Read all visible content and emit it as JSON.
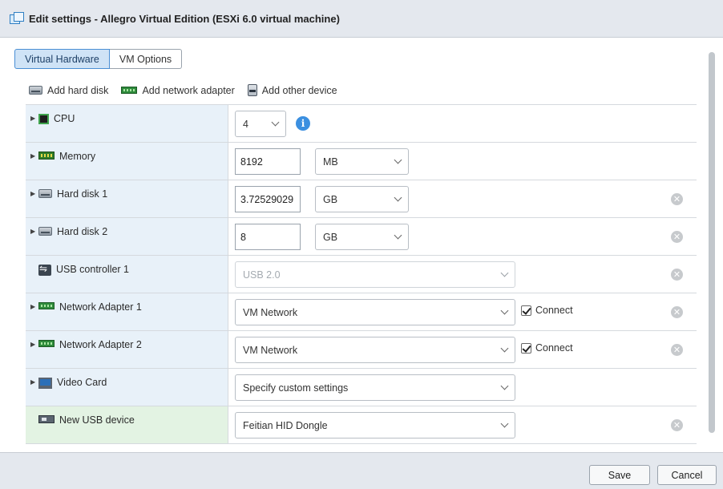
{
  "window": {
    "title": "Edit settings - Allegro Virtual Edition (ESXi 6.0 virtual machine)"
  },
  "tabs": [
    {
      "label": "Virtual Hardware",
      "active": true
    },
    {
      "label": "VM Options",
      "active": false
    }
  ],
  "toolbar": {
    "add_hard_disk": "Add hard disk",
    "add_network_adapter": "Add network adapter",
    "add_other_device": "Add other device"
  },
  "hardware": {
    "cpu": {
      "label": "CPU",
      "value": "4",
      "icon": "cpu-icon"
    },
    "memory": {
      "label": "Memory",
      "value": "8192",
      "unit": "MB",
      "icon": "memory-icon"
    },
    "hard_disk_1": {
      "label": "Hard disk 1",
      "value": "3.72529029",
      "unit": "GB",
      "icon": "hard-disk-icon"
    },
    "hard_disk_2": {
      "label": "Hard disk 2",
      "value": "8",
      "unit": "GB",
      "icon": "hard-disk-icon"
    },
    "usb_controller_1": {
      "label": "USB controller 1",
      "value": "USB 2.0",
      "icon": "usb-icon"
    },
    "network_adapter_1": {
      "label": "Network Adapter 1",
      "value": "VM Network",
      "connect_label": "Connect",
      "connected": true,
      "icon": "network-adapter-icon"
    },
    "network_adapter_2": {
      "label": "Network Adapter 2",
      "value": "VM Network",
      "connect_label": "Connect",
      "connected": true,
      "icon": "network-adapter-icon"
    },
    "video_card": {
      "label": "Video Card",
      "value": "Specify custom settings",
      "icon": "monitor-icon"
    },
    "new_usb_device": {
      "label": "New USB device",
      "value": "Feitian HID Dongle",
      "icon": "usb-device-icon"
    }
  },
  "footer": {
    "save_label": "Save",
    "cancel_label": "Cancel"
  },
  "colors": {
    "accent": "#3b8fe0",
    "label_bg": "#e8f1f9",
    "new_device_bg": "#e3f3e3",
    "header_bg": "#e4e8ee"
  }
}
